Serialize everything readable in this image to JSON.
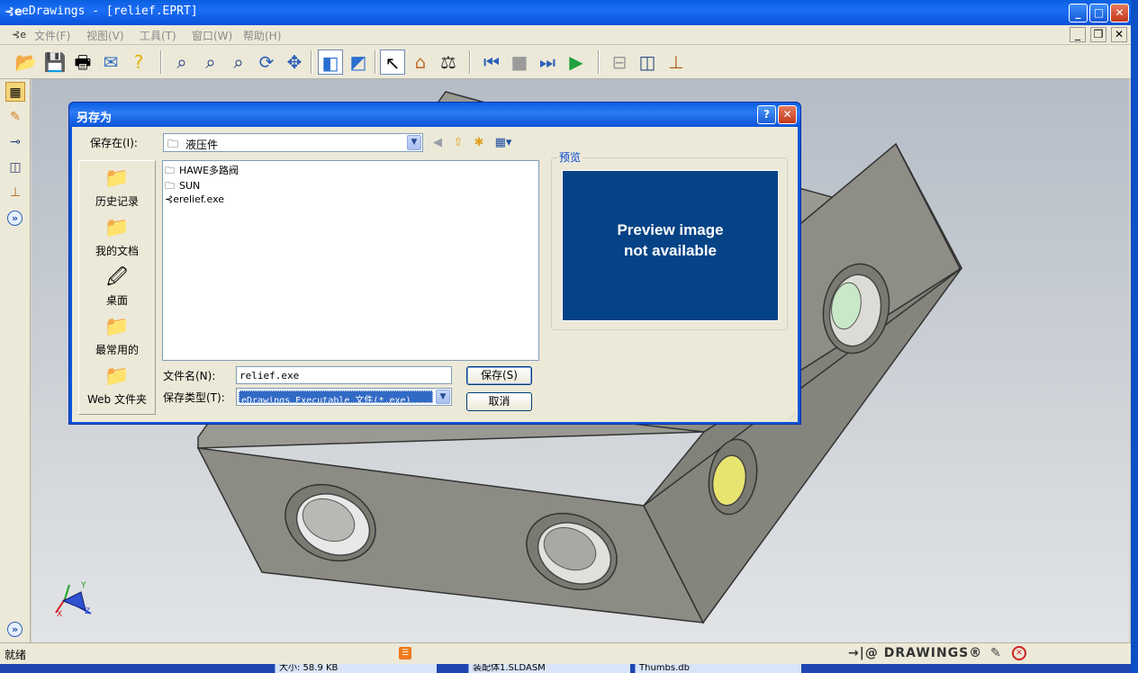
{
  "window": {
    "title": "eDrawings - [relief.EPRT]",
    "app_icon": "⊰e",
    "minimize": "_",
    "maximize": "□",
    "close": "✕"
  },
  "menu": {
    "items": [
      "文件(F)",
      "视图(V)",
      "工具(T)",
      "窗口(W)",
      "帮助(H)"
    ],
    "mdi_minimize": "_",
    "mdi_restore": "❐",
    "mdi_close": "✕"
  },
  "toolbar": {
    "icons": [
      "open-icon",
      "save-icon",
      "print-icon",
      "send-icon",
      "help-icon",
      "zoom-fit-icon",
      "zoom-area-icon",
      "zoom-icon",
      "rotate-icon",
      "pan-icon",
      "shaded-icon",
      "perspective-icon",
      "select-icon",
      "home-icon",
      "measure-icon",
      "first-frame-icon",
      "stop-icon",
      "next-frame-icon",
      "play-icon",
      "section-icon",
      "explode-icon",
      "stamp-icon"
    ]
  },
  "dialog": {
    "title": "另存为",
    "help": "?",
    "close": "✕",
    "lookin_label": "保存在(I):",
    "lookin_value": "液压件",
    "places": [
      "历史记录",
      "我的文档",
      "桌面",
      "最常用的",
      "Web 文件夹"
    ],
    "files": [
      {
        "name": "HAWE多路阀",
        "icon": "folder-icon"
      },
      {
        "name": "SUN",
        "icon": "folder-icon"
      },
      {
        "name": "relief.exe",
        "icon": "edrawings-exe-icon"
      }
    ],
    "preview_label": "预览",
    "preview_message_line1": "Preview image",
    "preview_message_line2": "not available",
    "filename_label": "文件名(N):",
    "filename_value": "relief.exe",
    "filetype_label": "保存类型(T):",
    "filetype_value": "eDrawings Executable 文件(*.exe)",
    "save_button": "保存(S)",
    "cancel_button": "取消"
  },
  "statusbar": {
    "status_text": "就绪",
    "logo_text": "DRAWINGS®",
    "logo_prefix": "→|@"
  },
  "taskbar": {
    "items": [
      "大小: 58.9 KB",
      "装配体1.SLDASM",
      "Thumbs.db"
    ]
  },
  "colors": {
    "xp_blue": "#0a55d8",
    "preview_bg": "#054386",
    "model_face": "#8c8c84"
  }
}
